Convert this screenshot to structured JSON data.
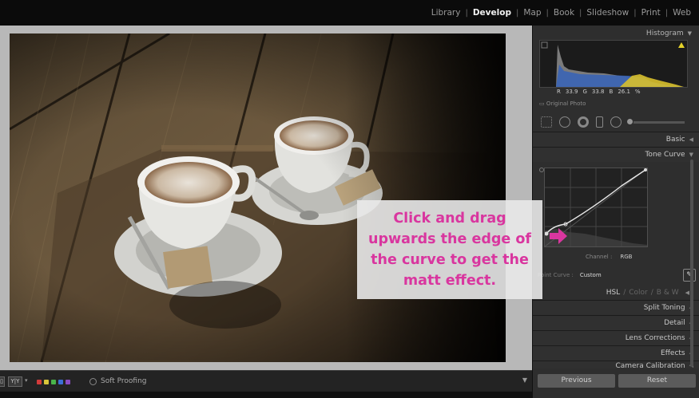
{
  "topbar": {
    "modules": [
      {
        "label": "Library",
        "active": false
      },
      {
        "label": "Develop",
        "active": true
      },
      {
        "label": "Map",
        "active": false
      },
      {
        "label": "Book",
        "active": false
      },
      {
        "label": "Slideshow",
        "active": false
      },
      {
        "label": "Print",
        "active": false
      },
      {
        "label": "Web",
        "active": false
      }
    ],
    "separator": "|"
  },
  "right_panel": {
    "histogram": {
      "label": "Histogram",
      "readout": {
        "r_label": "R",
        "r": "33.9",
        "g_label": "G",
        "g": "33.8",
        "b_label": "B",
        "b": "26.1",
        "unit": "%"
      },
      "original_photo": "Original Photo"
    },
    "sections": {
      "basic": "Basic",
      "tone_curve": "Tone Curve",
      "split_toning": "Split Toning",
      "detail": "Detail",
      "lens_corrections": "Lens Corrections",
      "effects": "Effects",
      "camera_calibration": "Camera Calibration"
    },
    "tone_curve": {
      "channel_label": "Channel :",
      "channel_value": "RGB",
      "point_curve_label": "Point Curve :",
      "point_curve_value": "Custom"
    },
    "hsl_tabs": {
      "hsl": "HSL",
      "color": "Color",
      "bw": "B & W",
      "sep": "/"
    },
    "buttons": {
      "previous": "Previous",
      "reset": "Reset"
    }
  },
  "annotation": {
    "text": "Click and drag upwards the edge of the curve to get the matt effect.",
    "color": "#d9369f"
  },
  "bottom_toolbar": {
    "view_modes": [
      "▯",
      "Y|Y"
    ],
    "flag_colors": [
      "#d23b3b",
      "#d8c53a",
      "#49b44a",
      "#3c6fd6",
      "#8a4cc2"
    ],
    "soft_proofing": "Soft Proofing"
  }
}
